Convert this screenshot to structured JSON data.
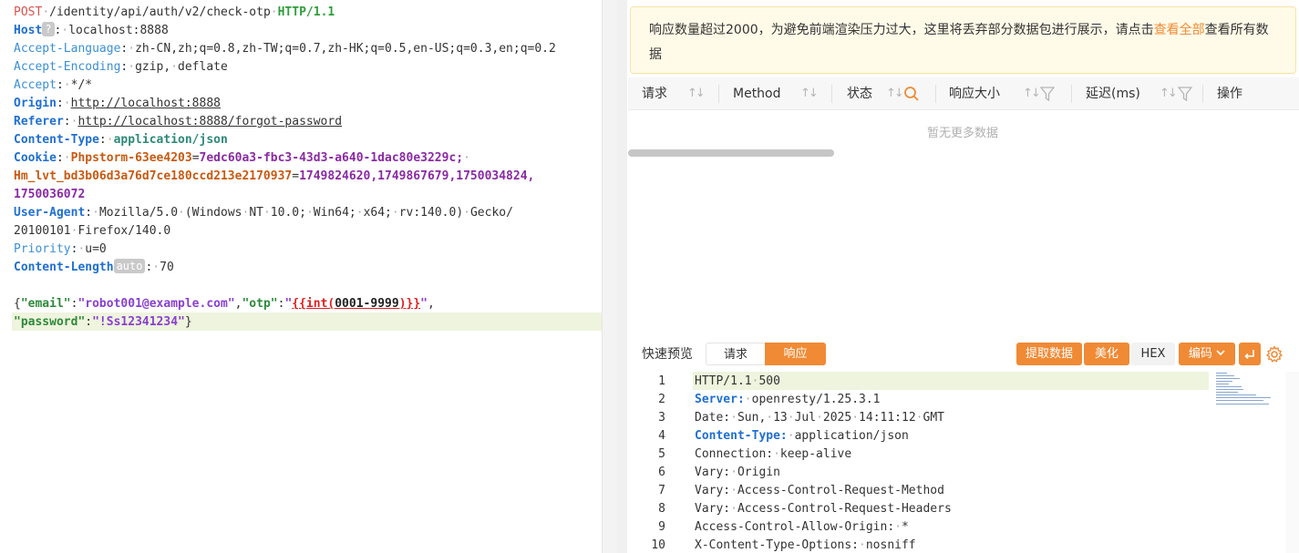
{
  "request": {
    "method": "POST",
    "path": "/identity/api/auth/v2/check-otp",
    "version": "HTTP/1.1",
    "headers": [
      {
        "name": "Host",
        "value": "localhost:8888",
        "badge": "?"
      },
      {
        "name": "Accept-Language",
        "value": "zh-CN,zh;q=0.8,zh-TW;q=0.7,zh-HK;q=0.5,en-US;q=0.3,en;q=0.2"
      },
      {
        "name": "Accept-Encoding",
        "value": "gzip, deflate"
      },
      {
        "name": "Accept",
        "value": "*/*"
      },
      {
        "name": "Origin",
        "value": "http://localhost:8888"
      },
      {
        "name": "Referer",
        "value": "http://localhost:8888/forgot-password"
      },
      {
        "name": "Content-Type",
        "value": "application/json"
      },
      {
        "name": "Cookie",
        "cookie1_name": "Phpstorm-63ee4203",
        "cookie1_value": "7edc60a3-fbc3-43d3-a640-1dac80e3229c;",
        "cookie2_name": "Hm_lvt_bd3b06d3a76d7ce180ccd213e2170937",
        "cookie2_value": "1749824620,1749867679,1750034824,",
        "cookie2_value_cont": "1750036072"
      },
      {
        "name": "User-Agent",
        "value": "Mozilla/5.0 (Windows NT 10.0; Win64; x64; rv:140.0) Gecko/",
        "value_cont": "20100101 Firefox/140.0"
      },
      {
        "name": "Priority",
        "value": "u=0"
      },
      {
        "name": "Content-Length",
        "value": "70",
        "badge": "auto"
      }
    ],
    "body": {
      "open": "{",
      "key_email": "\"email\"",
      "val_email": "\"robot001@example.com\"",
      "key_otp": "\"otp\"",
      "tpl_open": "{{int(",
      "tpl_range": "0001-9999",
      "tpl_close": ")}}",
      "key_password": "\"password\"",
      "val_password": "\"!Ss12341234\"",
      "close": "}"
    }
  },
  "notice": {
    "text_before": "响应数量超过2000，为避免前端渲染压力过大，这里将丢弃部分数据包进行展示，请点击",
    "link": "查看全部",
    "text_after": "查看所有数据"
  },
  "table": {
    "columns": [
      "请求",
      "Method",
      "状态",
      "响应大小",
      "延迟(ms)",
      "操作"
    ],
    "empty_text": "暂无更多数据"
  },
  "preview": {
    "label": "快速预览",
    "tab_request": "请求",
    "tab_response": "响应",
    "btn_extract": "提取数据",
    "btn_beautify": "美化",
    "btn_hex": "HEX",
    "btn_encode": "编码",
    "active_tab": "响应"
  },
  "response": {
    "lines": [
      {
        "n": "1",
        "a": "HTTP/1.1 500",
        "b": ""
      },
      {
        "n": "2",
        "a": "Server:",
        "b": " openresty/1.25.3.1"
      },
      {
        "n": "3",
        "a": "Date:",
        "b": " Sun, 13 Jul 2025 14:11:12 GMT"
      },
      {
        "n": "4",
        "a": "Content-Type:",
        "b": " application/json"
      },
      {
        "n": "5",
        "a": "Connection:",
        "b": " keep-alive"
      },
      {
        "n": "6",
        "a": "Vary:",
        "b": " Origin"
      },
      {
        "n": "7",
        "a": "Vary:",
        "b": " Access-Control-Request-Method"
      },
      {
        "n": "8",
        "a": "Vary:",
        "b": " Access-Control-Request-Headers"
      },
      {
        "n": "9",
        "a": "Access-Control-Allow-Origin:",
        "b": " *"
      },
      {
        "n": "10",
        "a": "X-Content-Type-Options:",
        "b": " nosniff"
      }
    ]
  },
  "colors": {
    "accent": "#f08a35",
    "header_key": "#1f6fd1",
    "line_highlight": "#eef4dd",
    "notice_bg": "#fffbe8"
  }
}
